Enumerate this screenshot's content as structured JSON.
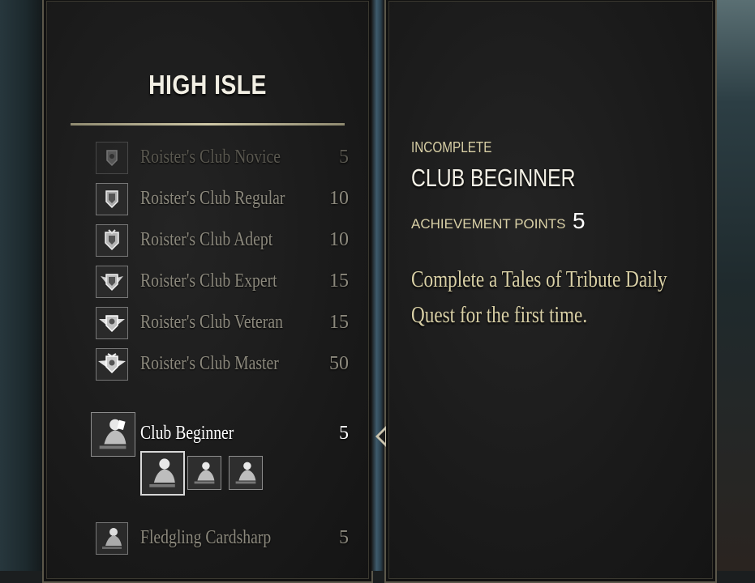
{
  "header": {
    "title": "HIGH ISLE"
  },
  "list": {
    "items": [
      {
        "name": "Roister's Club Novice",
        "points": "5",
        "icon": "shield-rank1-icon"
      },
      {
        "name": "Roister's Club Regular",
        "points": "10",
        "icon": "shield-rank2-icon"
      },
      {
        "name": "Roister's Club Adept",
        "points": "10",
        "icon": "shield-rank3-icon"
      },
      {
        "name": "Roister's Club Expert",
        "points": "15",
        "icon": "winged-shield-rank4-icon"
      },
      {
        "name": "Roister's Club Veteran",
        "points": "15",
        "icon": "winged-shield-rank5-icon"
      },
      {
        "name": "Roister's Club Master",
        "points": "50",
        "icon": "winged-shield-rank6-icon"
      }
    ],
    "selected": {
      "name": "Club Beginner",
      "points": "5",
      "icon": "card-player-icon"
    },
    "after": [
      {
        "name": "Fledgling Cardsharp",
        "points": "5",
        "icon": "card-player-icon"
      }
    ]
  },
  "detail": {
    "status": "INCOMPLETE",
    "name": "CLUB BEGINNER",
    "points_label": "ACHIEVEMENT POINTS",
    "points_value": "5",
    "description": "Complete a Tales of Tribute Daily Quest for the first time."
  },
  "colors": {
    "accent_gold": "#d9d0a6",
    "text_white": "#f4f1e6",
    "muted_text": "#8c897d"
  }
}
